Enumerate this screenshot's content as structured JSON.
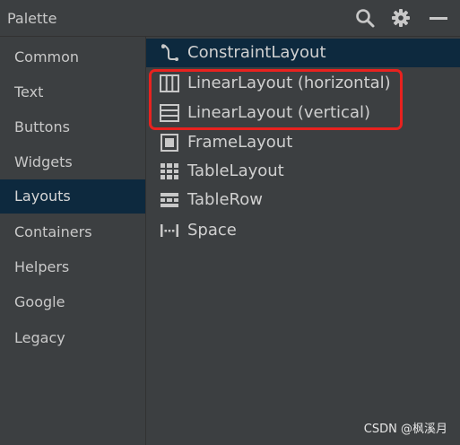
{
  "header": {
    "title": "Palette",
    "icons": [
      "search-icon",
      "gear-icon",
      "minimize-icon"
    ]
  },
  "sidebar": {
    "items": [
      {
        "label": "Common"
      },
      {
        "label": "Text"
      },
      {
        "label": "Buttons"
      },
      {
        "label": "Widgets"
      },
      {
        "label": "Layouts",
        "selected": true
      },
      {
        "label": "Containers"
      },
      {
        "label": "Helpers"
      },
      {
        "label": "Google"
      },
      {
        "label": "Legacy"
      }
    ]
  },
  "main": {
    "items": [
      {
        "label": "ConstraintLayout",
        "icon": "constraint-layout-icon",
        "selected": true
      },
      {
        "label": "LinearLayout (horizontal)",
        "icon": "linear-horizontal-icon"
      },
      {
        "label": "LinearLayout (vertical)",
        "icon": "linear-vertical-icon"
      },
      {
        "label": "FrameLayout",
        "icon": "frame-layout-icon"
      },
      {
        "label": "TableLayout",
        "icon": "table-layout-icon"
      },
      {
        "label": "TableRow",
        "icon": "table-row-icon"
      },
      {
        "label": "Space",
        "icon": "space-icon"
      }
    ]
  },
  "watermark": "CSDN @枫溪月",
  "colors": {
    "background": "#3c3f41",
    "selected": "#0d293e",
    "highlight": "#e8221f"
  }
}
